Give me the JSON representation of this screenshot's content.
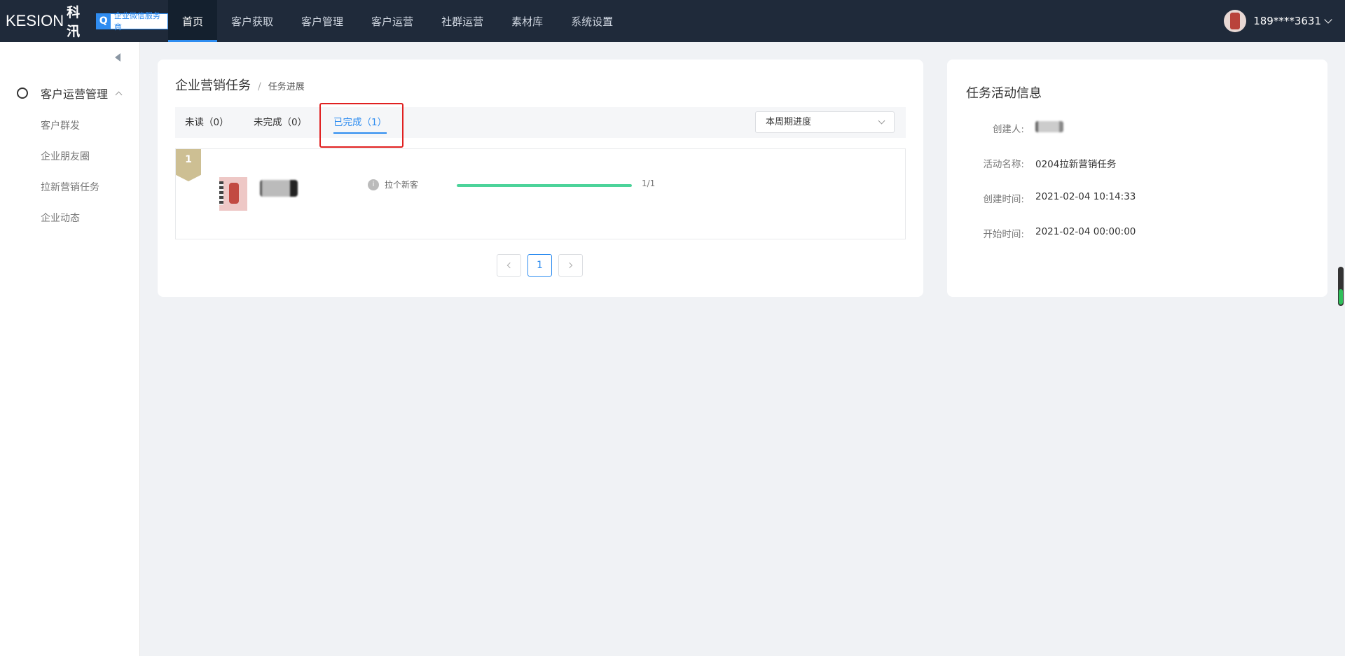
{
  "brand": {
    "logo_text": "KESION",
    "logo_cn": "科汛",
    "badge": "企业微信服务商"
  },
  "nav": {
    "items": [
      {
        "label": "首页",
        "active": true
      },
      {
        "label": "客户获取"
      },
      {
        "label": "客户管理"
      },
      {
        "label": "客户运营"
      },
      {
        "label": "社群运营"
      },
      {
        "label": "素材库"
      },
      {
        "label": "系统设置"
      }
    ]
  },
  "user": {
    "name": "189****3631"
  },
  "sidebar": {
    "group_label": "客户运营管理",
    "items": [
      {
        "label": "客户群发"
      },
      {
        "label": "企业朋友圈"
      },
      {
        "label": "拉新营销任务"
      },
      {
        "label": "企业动态"
      }
    ]
  },
  "breadcrumb": {
    "title": "企业营销任务",
    "separator": "/",
    "current": "任务进展"
  },
  "tabs": [
    {
      "label": "未读（0）"
    },
    {
      "label": "未完成（0）"
    },
    {
      "label": "已完成（1）",
      "active": true
    }
  ],
  "period_select": {
    "value": "本周期进度"
  },
  "task": {
    "rank": "1",
    "label": "拉个新客",
    "info_icon": "i",
    "progress": 1.0,
    "ratio": "1/1"
  },
  "pagination": {
    "current": "1"
  },
  "info_panel": {
    "title": "任务活动信息",
    "rows": [
      {
        "key": "创建人:",
        "value": ""
      },
      {
        "key": "活动名称:",
        "value": "0204拉新营销任务"
      },
      {
        "key": "创建时间:",
        "value": "2021-02-04 10:14:33"
      },
      {
        "key": "开始时间:",
        "value": "2021-02-04 00:00:00"
      }
    ]
  },
  "colors": {
    "accent": "#2d8cf0",
    "nav_bg": "#1f2a3a",
    "progress": "#4cd39a",
    "rank": "#cdbf93",
    "highlight": "#e02020"
  }
}
